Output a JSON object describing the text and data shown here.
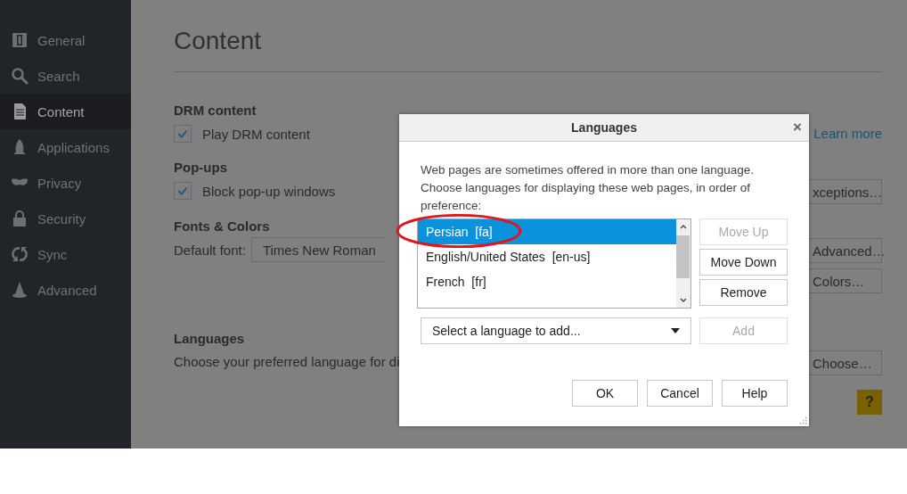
{
  "sidebar": {
    "items": [
      {
        "label": "General",
        "selected": false
      },
      {
        "label": "Search",
        "selected": false
      },
      {
        "label": "Content",
        "selected": true
      },
      {
        "label": "Applications",
        "selected": false
      },
      {
        "label": "Privacy",
        "selected": false
      },
      {
        "label": "Security",
        "selected": false
      },
      {
        "label": "Sync",
        "selected": false
      },
      {
        "label": "Advanced",
        "selected": false
      }
    ]
  },
  "page": {
    "title": "Content",
    "drm": {
      "heading": "DRM content",
      "checkbox": {
        "label": "Play DRM content",
        "checked": true
      },
      "link": "Learn more"
    },
    "popups": {
      "heading": "Pop-ups",
      "checkbox": {
        "label": "Block pop-up windows",
        "checked": true
      },
      "button": "xceptions…"
    },
    "fonts": {
      "heading": "Fonts & Colors",
      "font_label": "Default font:",
      "font_value": "Times New Roman",
      "buttons": [
        "Advanced…",
        "Colors…"
      ]
    },
    "languages": {
      "heading": "Languages",
      "description": "Choose your preferred language for di",
      "button": "Choose…"
    },
    "help_button": "?"
  },
  "dialog": {
    "title": "Languages",
    "close": "×",
    "description": "Web pages are sometimes offered in more than one language. Choose languages for displaying these web pages, in order of preference:",
    "languages": [
      {
        "label": "Persian  [fa]",
        "selected": true
      },
      {
        "label": "English/United States  [en-us]",
        "selected": false
      },
      {
        "label": "French  [fr]",
        "selected": false
      }
    ],
    "side_buttons": [
      {
        "label": "Move Up",
        "disabled": true
      },
      {
        "label": "Move Down",
        "disabled": false
      },
      {
        "label": "Remove",
        "disabled": false
      }
    ],
    "add_select": {
      "placeholder": "Select a language to add..."
    },
    "add_button": {
      "label": "Add",
      "disabled": true
    },
    "footer_buttons": [
      "OK",
      "Cancel",
      "Help"
    ]
  }
}
